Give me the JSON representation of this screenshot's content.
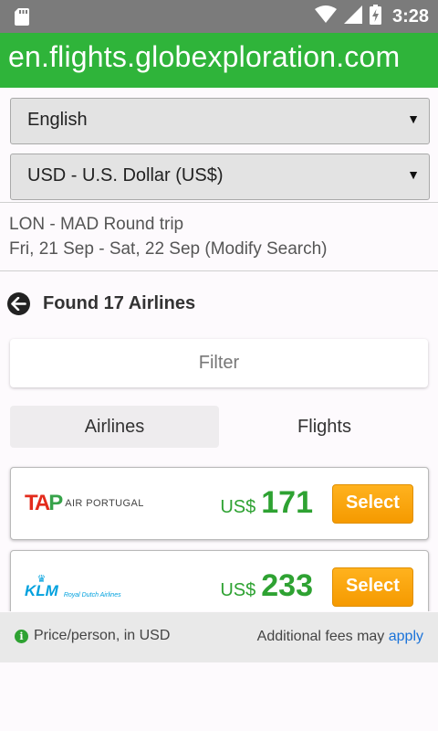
{
  "status_bar": {
    "time": "3:28",
    "icons": [
      "sd-card-icon",
      "wifi-icon",
      "signal-icon",
      "battery-charging-icon"
    ]
  },
  "browser": {
    "url": "en.flights.globexploration.com"
  },
  "language_select": {
    "value": "English"
  },
  "currency_select": {
    "value": "USD - U.S. Dollar (US$)"
  },
  "trip": {
    "route": "LON - MAD Round trip",
    "dates": "Fri, 21 Sep - Sat, 22 Sep",
    "modify": "(Modify Search)"
  },
  "results": {
    "title": "Found 17 Airlines",
    "filter_label": "Filter",
    "tabs": [
      {
        "label": "Airlines",
        "active": true
      },
      {
        "label": "Flights",
        "active": false
      }
    ],
    "airlines": [
      {
        "logo_mark": "TAP",
        "logo_text": "AIR PORTUGAL",
        "currency": "US$",
        "price": "171",
        "select_label": "Select"
      },
      {
        "logo_mark": "KLM",
        "logo_text": "Royal Dutch Airlines",
        "currency": "US$",
        "price": "233",
        "select_label": "Select"
      }
    ]
  },
  "footer": {
    "info": "Price/person, in USD",
    "fees_text": "Additional fees may",
    "fees_link": "apply"
  },
  "colors": {
    "brand_green": "#2fb43a",
    "price_green": "#2ea232",
    "select_orange": "#f59a00",
    "link_blue": "#1a73d9"
  }
}
